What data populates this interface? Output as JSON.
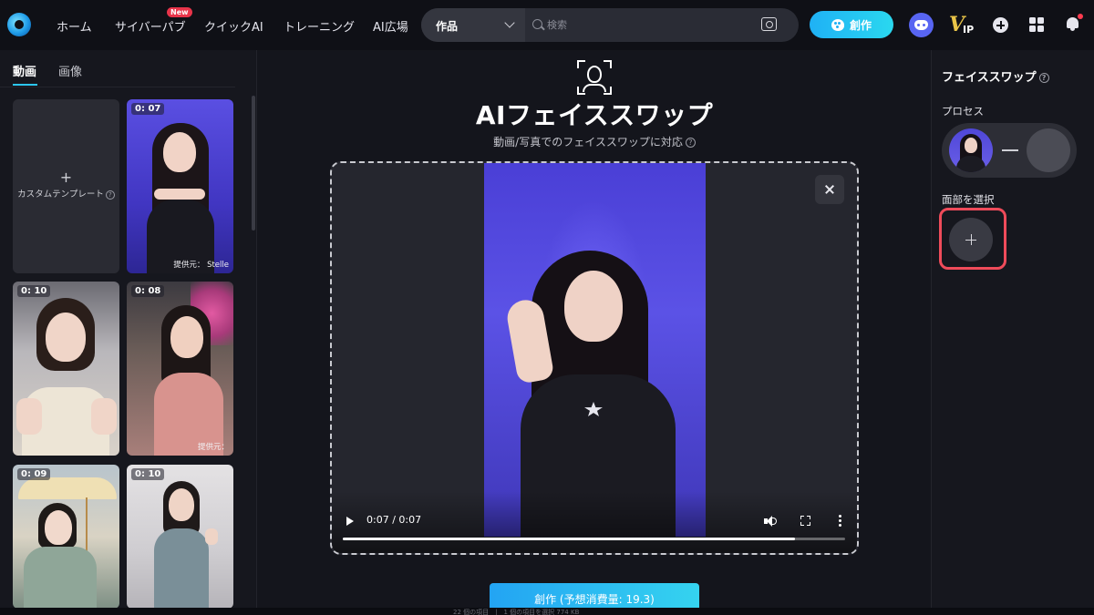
{
  "nav": {
    "items": [
      "ホーム",
      "サイバーパブ",
      "クイックAI",
      "トレーニング",
      "AI広場"
    ],
    "new_badge": "New",
    "search": {
      "category": "作品",
      "placeholder": "検索"
    },
    "create_label": "創作"
  },
  "left": {
    "tabs": [
      "動画",
      "画像"
    ],
    "custom_template_label": "カスタムテンプレート",
    "thumbnails": [
      {
        "duration": "0: 07",
        "credit": "提供元： Stelle"
      },
      {
        "duration": "0: 10",
        "credit": ""
      },
      {
        "duration": "0: 08",
        "credit": "提供元："
      },
      {
        "duration": "0: 09",
        "credit": ""
      },
      {
        "duration": "0: 10",
        "credit": ""
      }
    ]
  },
  "center": {
    "title": "AIフェイススワップ",
    "subtitle": "動画/写真でのフェイススワップに対応",
    "player": {
      "time": "0:07 / 0:07",
      "progress": 0.9
    },
    "create_button": "創作 (予想消費量: 19.3)"
  },
  "right": {
    "title": "フェイススワップ",
    "process_label": "プロセス",
    "select_face_label": "面部を選択"
  },
  "status": {
    "text": "22 個の項目　|　1 個の項目を選択  774 KB"
  },
  "colors": {
    "accent": "#2cc6f0",
    "highlight": "#ef4b5a",
    "panel": "#16171e"
  }
}
